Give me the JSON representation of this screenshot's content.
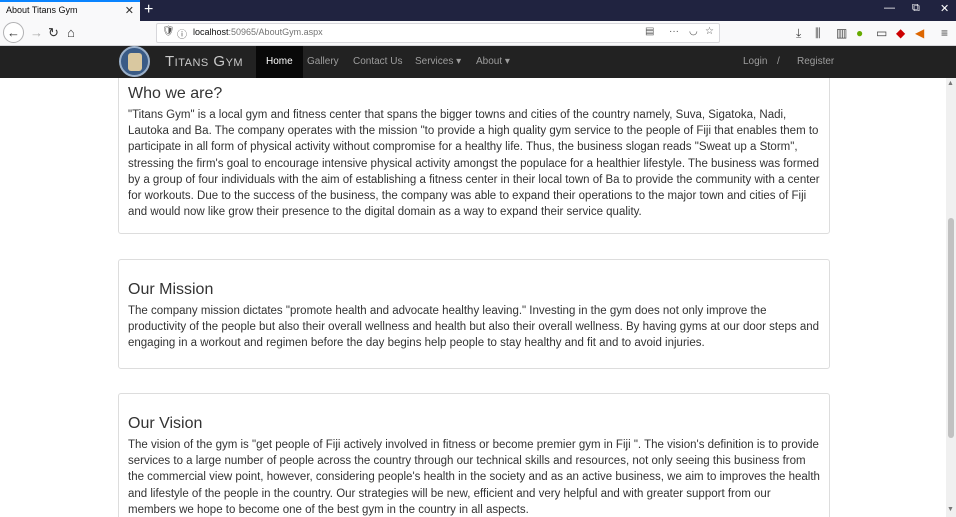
{
  "browser": {
    "tab_title": "About Titans Gym",
    "tab_close": "✕",
    "new_tab": "+",
    "url_host": "localhost",
    "url_path": ":50965/AboutGym.aspx",
    "window_buttons": {
      "minimize": "—",
      "restore": "⧉",
      "close": "✕"
    },
    "icons": [
      "back-icon",
      "forward-icon",
      "reload-icon",
      "home-icon",
      "shield-icon",
      "info-icon",
      "reader-view-icon",
      "more-icon",
      "pocket-icon",
      "bookmark-star-icon",
      "download-icon",
      "library-icon",
      "sidebar-icon",
      "extension-icon",
      "hamburger-menu-icon"
    ]
  },
  "site": {
    "brand": "Titans Gym",
    "nav": [
      {
        "label": "Home",
        "active": true
      },
      {
        "label": "Gallery",
        "active": false
      },
      {
        "label": "Contact Us",
        "active": false
      },
      {
        "label": "Services ▾",
        "active": false
      },
      {
        "label": "About ▾",
        "active": false
      }
    ],
    "login": "Login",
    "separator": "/",
    "register": "Register"
  },
  "sections": [
    {
      "title": "Who we are?",
      "body": "\"Titans Gym\" is a local gym and fitness center that spans the bigger towns and cities of the country namely, Suva, Sigatoka, Nadi, Lautoka and Ba. The company operates with the mission \"to provide a high quality gym service to the people of Fiji that enables them to participate in all form of physical activity without compromise for a healthy life. Thus, the business slogan reads \"Sweat up a Storm\", stressing the firm's goal to encourage intensive physical activity amongst the populace for a healthier lifestyle. The business was formed by a group of four individuals with the aim of establishing a fitness center in their local town of Ba to provide the community with a center for workouts. Due to the success of the business, the company was able to expand their operations to the major town and cities of Fiji and would now like grow their presence to the digital domain as a way to expand their service quality."
    },
    {
      "title": "Our Mission",
      "body": "The company mission dictates \"promote health and advocate healthy leaving.\" Investing in the gym does not only improve the productivity of the people but also their overall wellness and health but also their overall wellness. By having gyms at our door steps and engaging in a workout and regimen before the day begins help people to stay healthy and fit and to avoid injuries."
    },
    {
      "title": "Our Vision",
      "body": "The vision of the gym is \"get people of Fiji actively involved in fitness or become premier gym in Fiji \". The vision's definition is to provide services to a large number of people across the country through our technical skills and resources, not only seeing this business from the commercial view point, however, considering people's health in the society and as an active business, we aim to improves the health and lifestyle of the people in the country. Our strategies will be new, efficient and very helpful and with greater support from our members we hope to become one of the best gym in the country in all aspects."
    }
  ]
}
